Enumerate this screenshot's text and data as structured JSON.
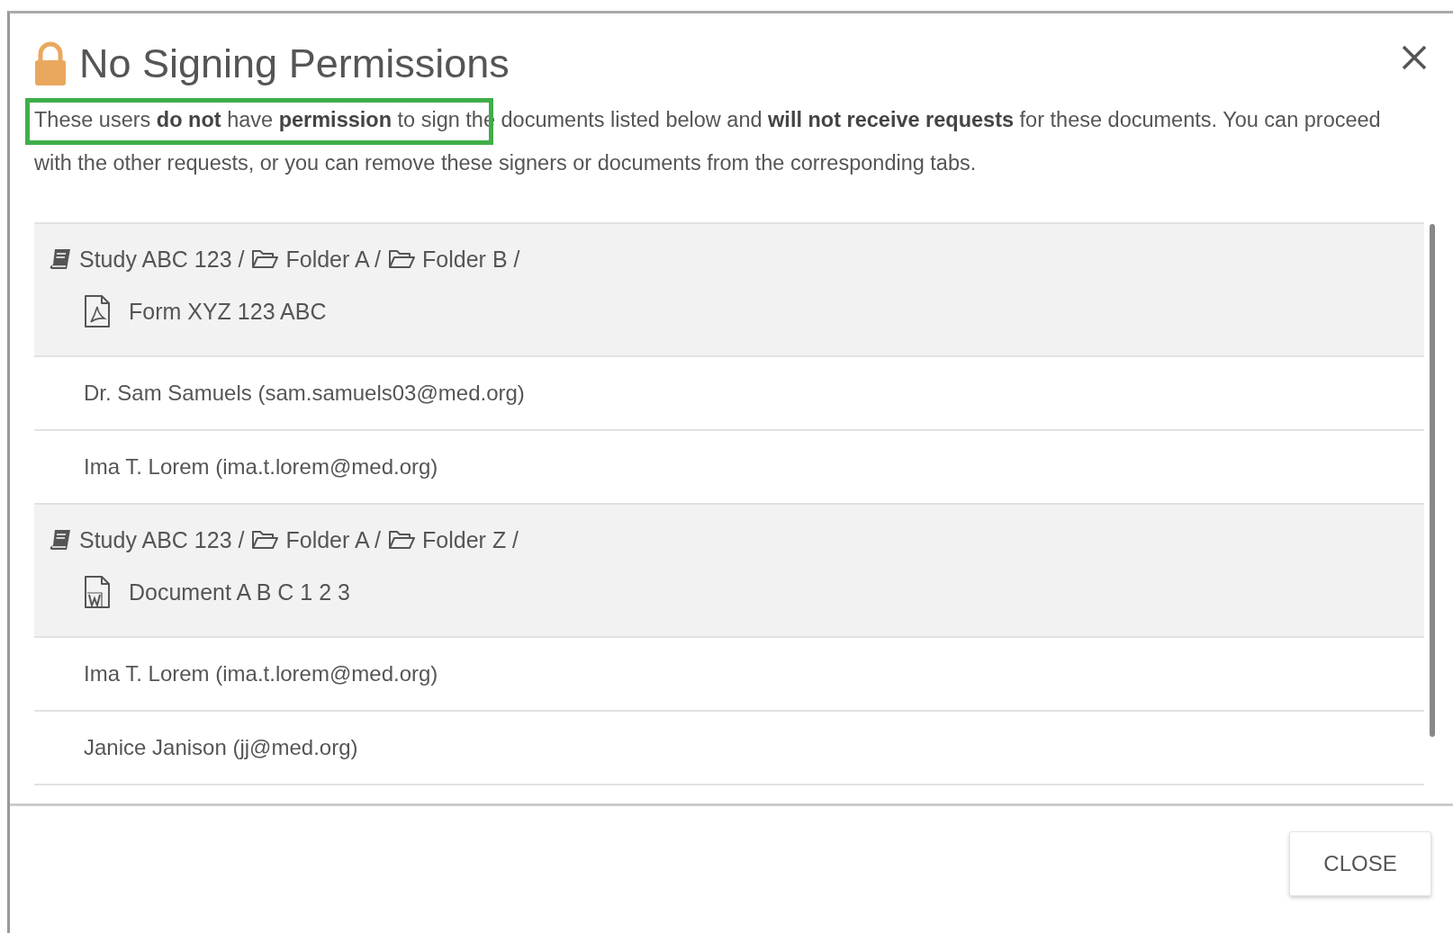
{
  "dialog": {
    "title": "No Signing Permissions",
    "message": "These users **do not** have **permission** to sign the documents listed below and **will not receive requests** for these documents. You can proceed with the other requests, or you can remove these signers or documents from the corresponding tabs.",
    "highlight": true,
    "groups": [
      {
        "path": [
          {
            "kind": "study",
            "label": "Study ABC 123 /"
          },
          {
            "kind": "folder",
            "label": "Folder A /"
          },
          {
            "kind": "folder",
            "label": "Folder B /"
          }
        ],
        "document": {
          "kind": "pdf",
          "name": "Form XYZ 123 ABC"
        },
        "signers": [
          "Dr. Sam Samuels (sam.samuels03@med.org)",
          "Ima T. Lorem (ima.t.lorem@med.org)"
        ]
      },
      {
        "path": [
          {
            "kind": "study",
            "label": "Study ABC 123 /"
          },
          {
            "kind": "folder",
            "label": "Folder A /"
          },
          {
            "kind": "folder",
            "label": "Folder Z /"
          }
        ],
        "document": {
          "kind": "word",
          "name": "Document A B C 1 2 3"
        },
        "signers": [
          "Ima T. Lorem (ima.t.lorem@med.org)",
          "Janice Janison (jj@med.org)"
        ]
      }
    ],
    "close_button": "CLOSE"
  }
}
